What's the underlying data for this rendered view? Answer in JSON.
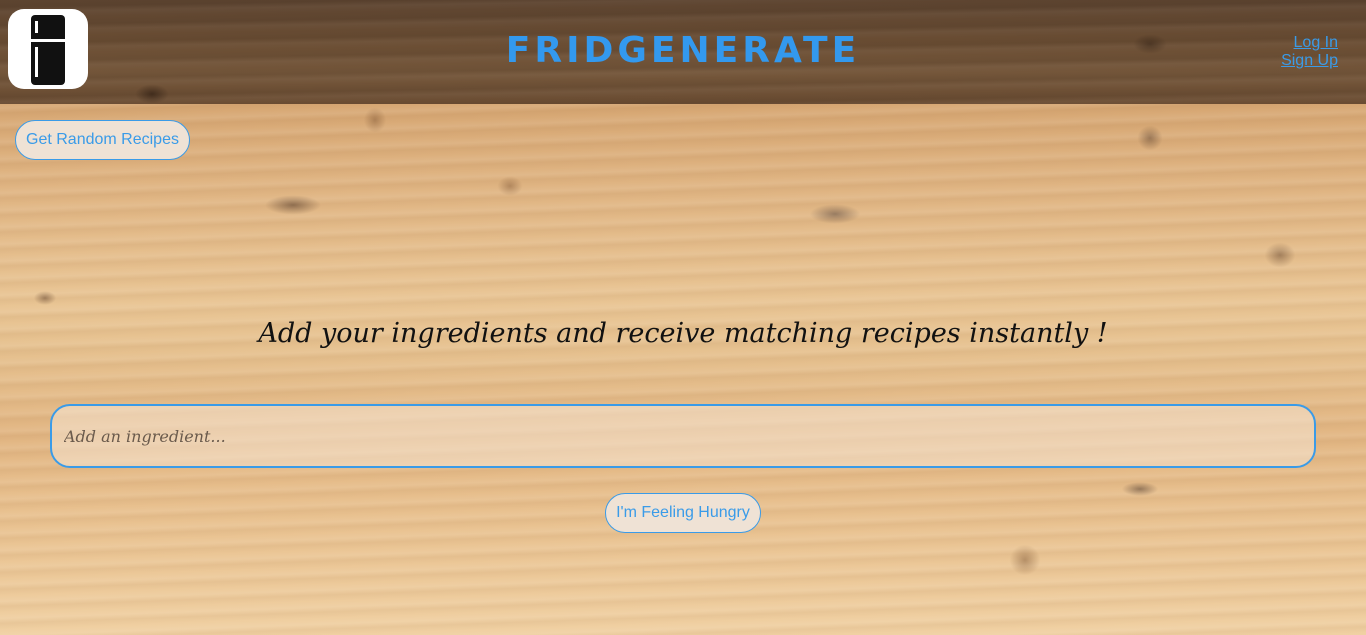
{
  "app": {
    "title": "FRIDGENERATE",
    "logo_icon": "fridge-icon"
  },
  "header": {
    "auth": {
      "login_label": "Log In",
      "signup_label": "Sign Up"
    }
  },
  "main": {
    "random_button_label": "Get Random Recipes",
    "tagline": "Add your ingredients and receive matching recipes instantly !",
    "ingredient_input": {
      "placeholder": "Add an ingredient...",
      "value": ""
    },
    "hungry_button_label": "I'm Feeling Hungry"
  },
  "colors": {
    "accent": "#3a9be8",
    "button_bg": "#efe2d5",
    "header_bg": "#6e5034",
    "tagline_text": "#111111"
  }
}
